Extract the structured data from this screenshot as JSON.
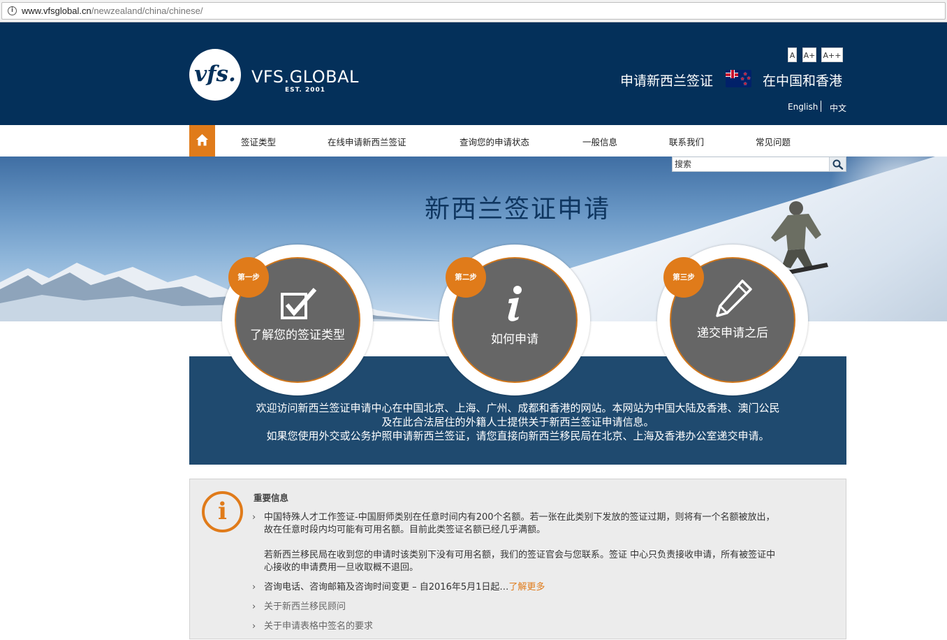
{
  "browser": {
    "url_host": "www.vfsglobal.cn",
    "url_path": "/newzealand/china/chinese/"
  },
  "header": {
    "logo_mark": "vfs.",
    "logo_name": "VFS.GLOBAL",
    "logo_est": "EST. 2001",
    "tagline_left": "申请新西兰签证",
    "tagline_right": "在中国和香港",
    "font_sizes": [
      "A",
      "A+",
      "A++"
    ],
    "lang_english": "English",
    "lang_chinese": "中文"
  },
  "nav": {
    "items": [
      "签证类型",
      "在线申请新西兰签证",
      "查询您的申请状态",
      "一般信息",
      "联系我们",
      "常见问题"
    ]
  },
  "hero": {
    "title": "新西兰签证申请",
    "search_placeholder": "搜索"
  },
  "steps": [
    {
      "badge": "第一步",
      "label": "了解您的签证类型",
      "icon": "checkbox-icon"
    },
    {
      "badge": "第二步",
      "label": "如何申请",
      "icon": "info-icon"
    },
    {
      "badge": "第三步",
      "label": "递交申请之后",
      "icon": "pencil-icon"
    }
  ],
  "welcome": {
    "line1": "欢迎访问新西兰签证申请中心在中国北京、上海、广州、成都和香港的网站。本网站为中国大陆及香港、澳门公民",
    "line2": "及在此合法居住的外籍人士提供关于新西兰签证申请信息。",
    "line3": "如果您使用外交或公务护照申请新西兰签证，请您直接向新西兰移民局在北京、上海及香港办公室递交申请。"
  },
  "important": {
    "title": "重要信息",
    "item1_p1": "中国特殊人才工作签证-中国厨师类别在任意时间内有200个名额。若一张在此类别下发放的签证过期，则将有一个名额被放出，故在任意时段内均可能有可用名额。目前此类签证名额已经几乎满额。",
    "item1_p2": "若新西兰移民局在收到您的申请时该类别下没有可用名额，我们的签证官会与您联系。签证 中心只负责接收申请，所有被签证中心接收的申请费用一旦收取概不退回。",
    "item2": "咨询电话、咨询邮箱及咨询时间变更 – 自2016年5月1日起…",
    "item2_more": "了解更多",
    "item3": "关于新西兰移民顾问",
    "item4": "关于申请表格中签名的要求"
  },
  "colors": {
    "header_navy": "#04305a",
    "accent_orange": "#e07b1a",
    "band_blue": "#1f4a6f",
    "step_gray": "#666666"
  }
}
